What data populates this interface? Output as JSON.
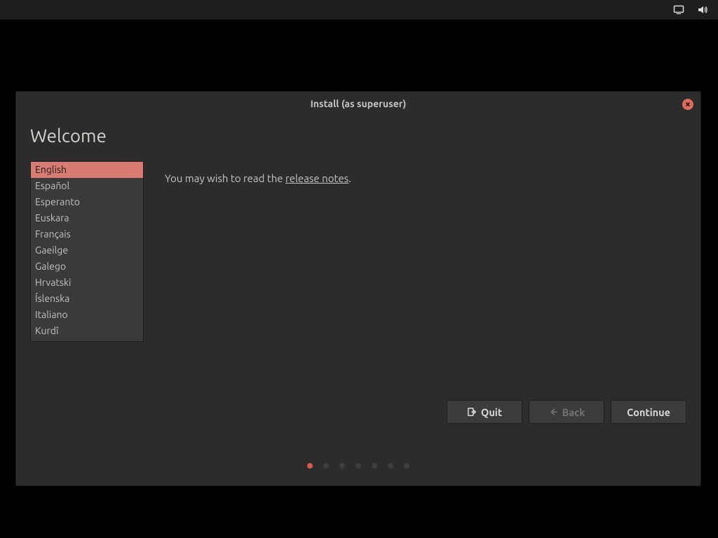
{
  "topbar": {
    "network_icon": "display-icon",
    "sound_icon": "volume-icon"
  },
  "dialog": {
    "title": "Install (as superuser)",
    "heading": "Welcome",
    "message_prefix": "You may wish to read the ",
    "release_notes_label": "release notes",
    "message_suffix": ".",
    "languages": [
      {
        "label": "English",
        "selected": true
      },
      {
        "label": "Español",
        "selected": false
      },
      {
        "label": "Esperanto",
        "selected": false
      },
      {
        "label": "Euskara",
        "selected": false
      },
      {
        "label": "Français",
        "selected": false
      },
      {
        "label": "Gaeilge",
        "selected": false
      },
      {
        "label": "Galego",
        "selected": false
      },
      {
        "label": "Hrvatski",
        "selected": false
      },
      {
        "label": "Íslenska",
        "selected": false
      },
      {
        "label": "Italiano",
        "selected": false
      },
      {
        "label": "Kurdî",
        "selected": false
      }
    ],
    "buttons": {
      "quit": "Quit",
      "back": "Back",
      "continue": "Continue"
    },
    "progress": {
      "total_steps": 7,
      "current_step": 1
    }
  }
}
